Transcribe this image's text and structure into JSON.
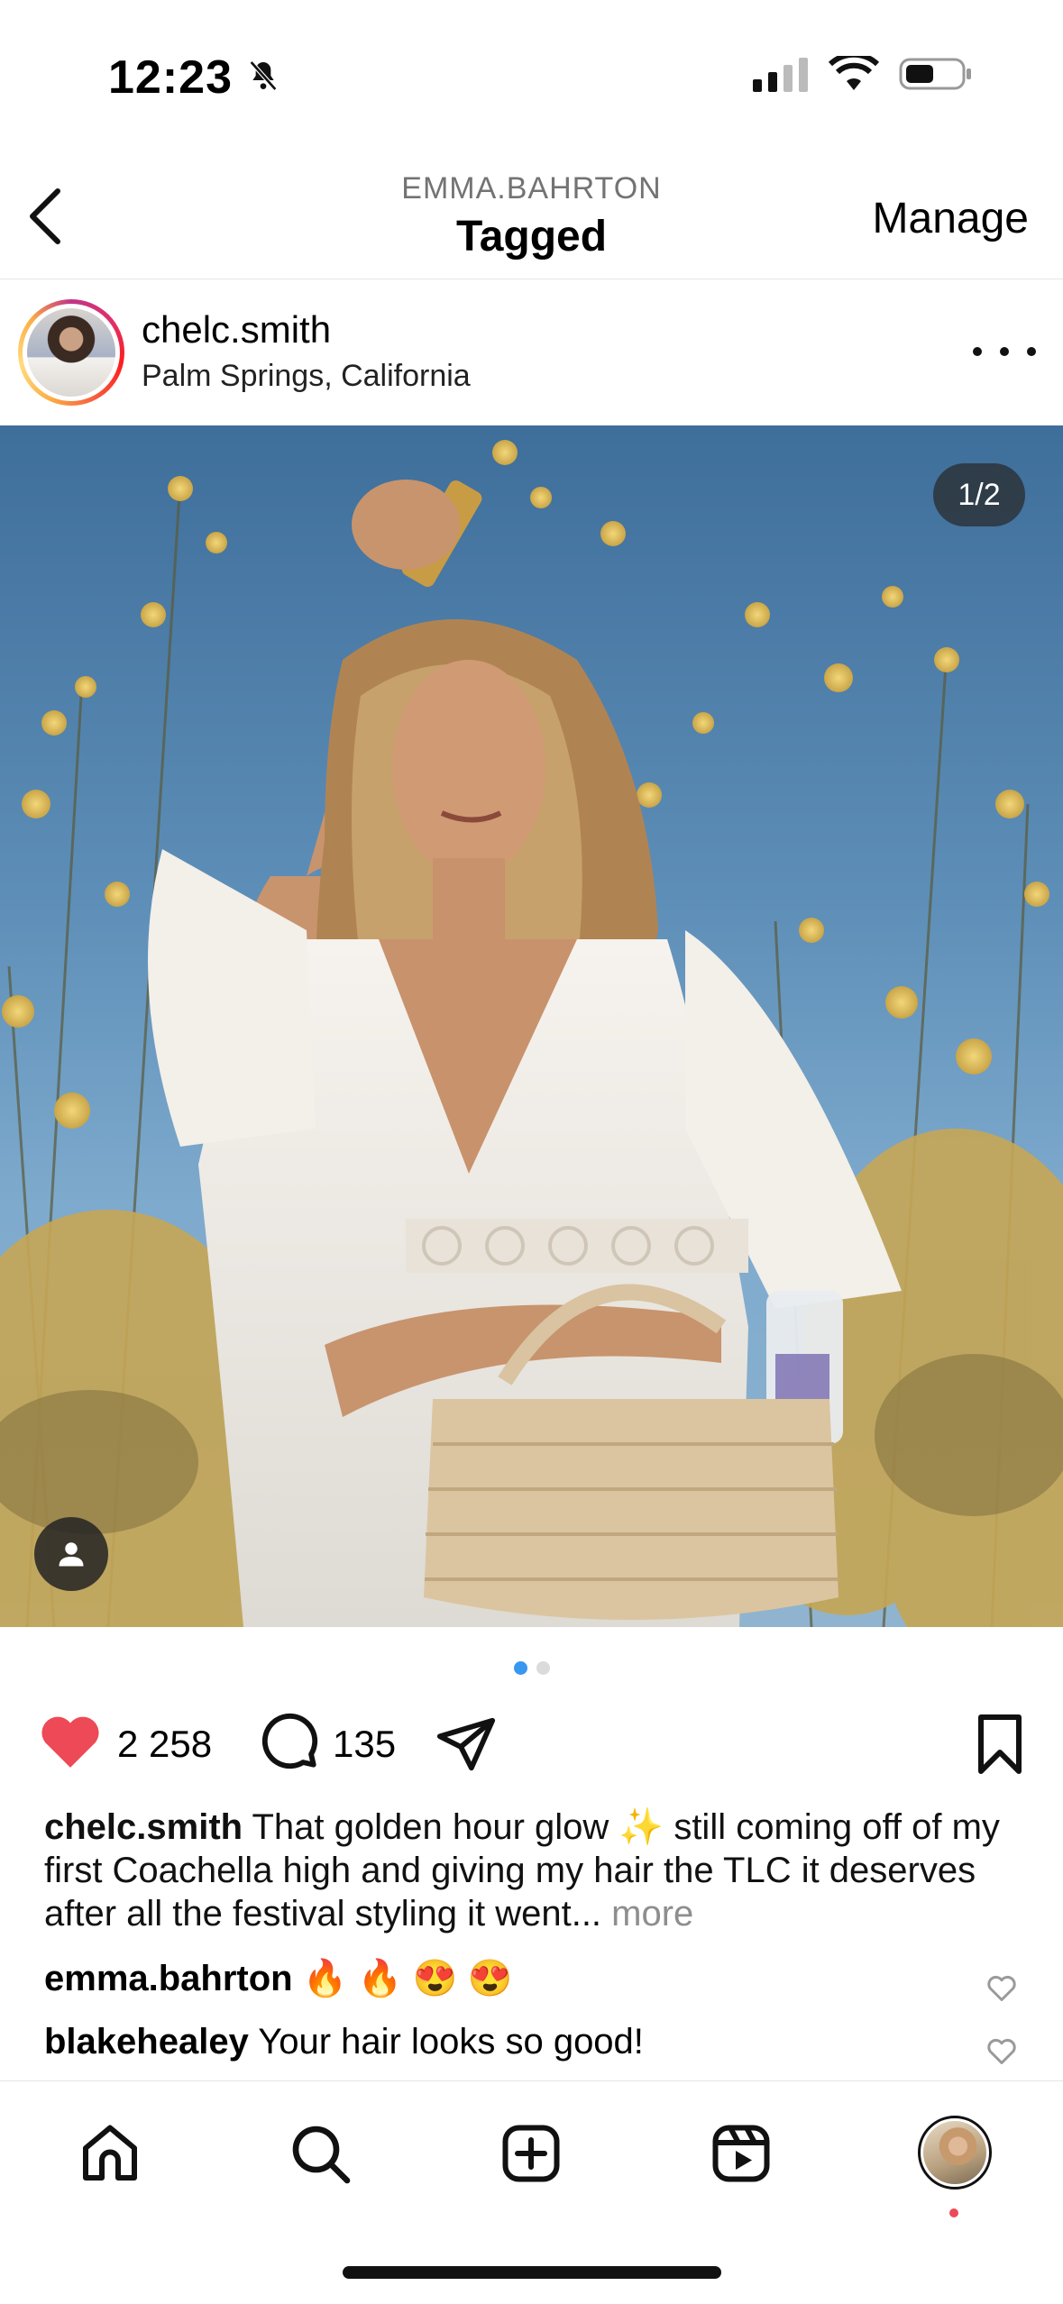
{
  "status_bar": {
    "time": "12:23"
  },
  "header": {
    "subtitle": "EMMA.BAHRTON",
    "title": "Tagged",
    "manage_label": "Manage"
  },
  "post": {
    "username": "chelc.smith",
    "location": "Palm Springs, California",
    "image_counter": "1/2",
    "carousel": {
      "total": 2,
      "active_index": 0
    },
    "likes": "2 258",
    "comments_count": "135",
    "caption": {
      "username": "chelc.smith",
      "text": "That golden hour glow ✨ still coming off of my first Coachella high and giving my hair the TLC it deserves after all the festival styling it went...",
      "more_label": "more"
    },
    "comments": [
      {
        "username": "emma.bahrton",
        "text": "🔥 🔥 😍 😍"
      },
      {
        "username": "blakehealey",
        "text": "Your hair looks so good!"
      }
    ]
  },
  "colors": {
    "like_red": "#ed4956",
    "active_dot": "#3897f0",
    "inactive_dot": "#dbdbdb"
  }
}
